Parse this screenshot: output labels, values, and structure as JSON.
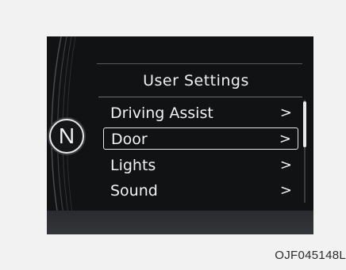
{
  "gear_indicator": "N",
  "menu": {
    "title": "User Settings",
    "items": [
      {
        "label": "Driving Assist",
        "chevron": ">",
        "selected": false
      },
      {
        "label": "Door",
        "chevron": ">",
        "selected": true
      },
      {
        "label": "Lights",
        "chevron": ">",
        "selected": false
      },
      {
        "label": "Sound",
        "chevron": ">",
        "selected": false
      }
    ]
  },
  "figure_code": "OJF045148L",
  "icons": [
    "gear-indicator-icon",
    "chevron-right-icon"
  ],
  "colors": {
    "screen_bg": "#111214",
    "text": "#f2f2f2",
    "page_bg": "#f2f2f2"
  }
}
